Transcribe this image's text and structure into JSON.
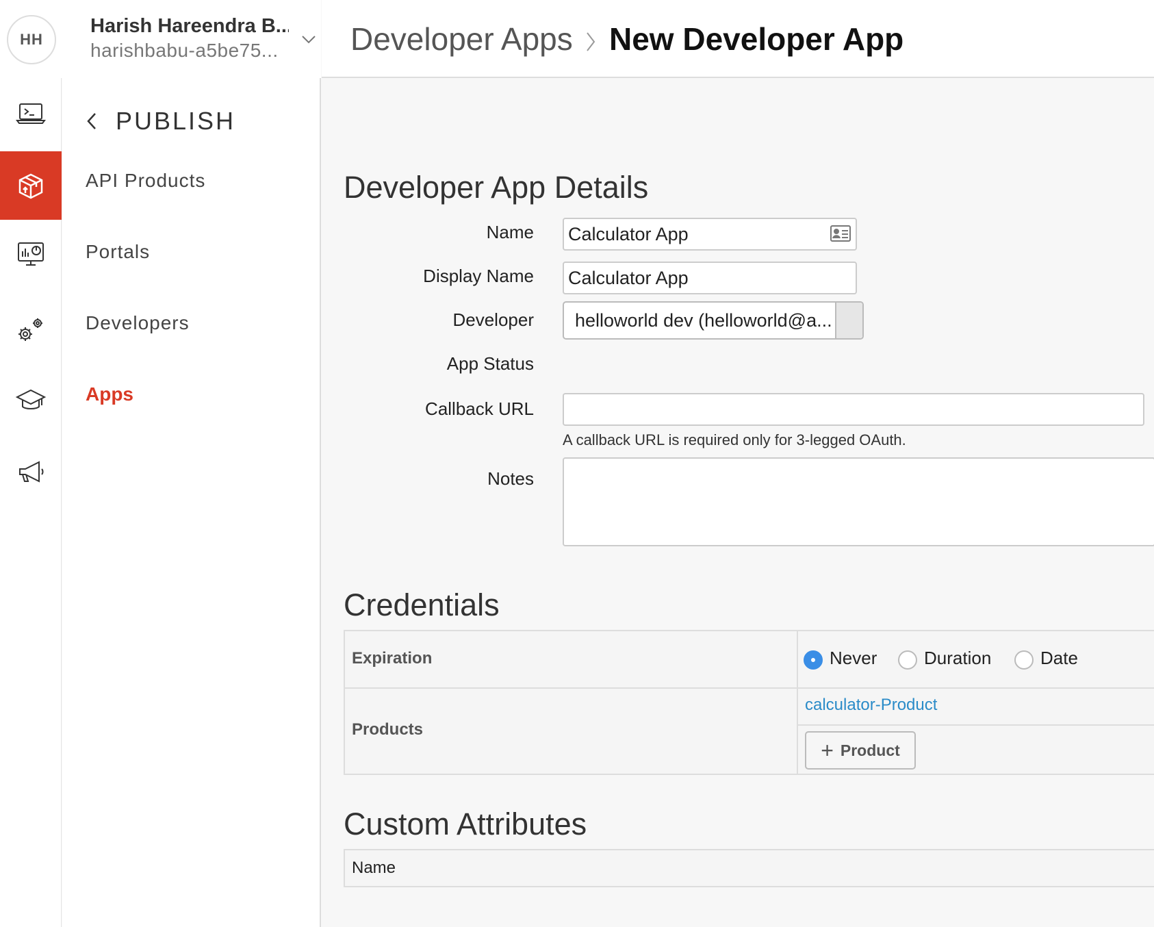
{
  "user": {
    "initials": "HH",
    "name": "Harish Hareendra B...",
    "org": "harishbabu-a5be75..."
  },
  "rail": {
    "items": [
      {
        "icon": "terminal-laptop-icon"
      },
      {
        "icon": "package-box-icon",
        "active": true
      },
      {
        "icon": "analytics-monitor-icon"
      },
      {
        "icon": "gears-icon"
      },
      {
        "icon": "graduation-cap-icon"
      },
      {
        "icon": "megaphone-icon"
      }
    ]
  },
  "section_nav": {
    "title": "PUBLISH",
    "items": [
      {
        "label": "API Products"
      },
      {
        "label": "Portals"
      },
      {
        "label": "Developers"
      },
      {
        "label": "Apps",
        "active": true
      }
    ]
  },
  "breadcrumb": {
    "parent": "Developer Apps",
    "current": "New Developer App"
  },
  "details": {
    "heading": "Developer App Details",
    "name_label": "Name",
    "name_value": "Calculator App",
    "display_name_label": "Display Name",
    "display_name_value": "Calculator App",
    "developer_label": "Developer",
    "developer_value": "helloworld dev (helloworld@a...",
    "app_status_label": "App Status",
    "callback_label": "Callback URL",
    "callback_value": "",
    "callback_hint": "A callback URL is required only for 3-legged OAuth.",
    "notes_label": "Notes",
    "notes_value": ""
  },
  "credentials": {
    "heading": "Credentials",
    "expiration_label": "Expiration",
    "expiration_options": [
      {
        "label": "Never",
        "checked": true
      },
      {
        "label": "Duration",
        "checked": false
      },
      {
        "label": "Date",
        "checked": false
      }
    ],
    "products_label": "Products",
    "products": [
      "calculator-Product"
    ],
    "add_product_label": "Product"
  },
  "custom_attributes": {
    "heading": "Custom Attributes",
    "columns": [
      "Name"
    ]
  },
  "colors": {
    "accent": "#d93a25",
    "link": "#2a8bc8",
    "radio_checked": "#3a8ee6"
  }
}
